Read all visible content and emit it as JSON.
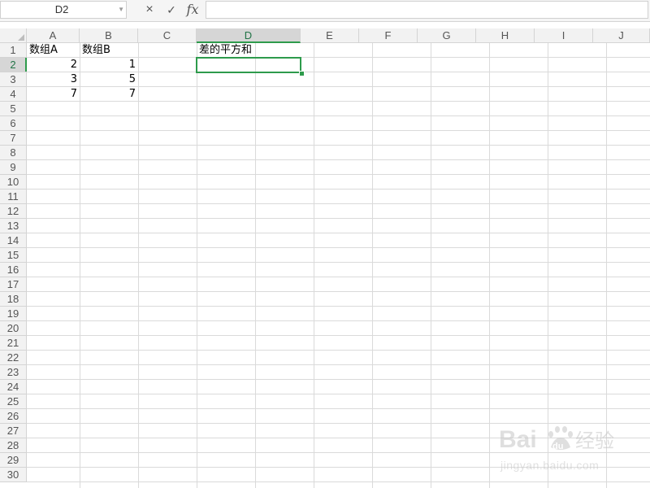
{
  "formula_bar": {
    "name_box": "D2",
    "cancel_icon": "×",
    "enter_icon": "✓",
    "fx_label": "fx",
    "formula_value": ""
  },
  "columns": [
    "A",
    "B",
    "C",
    "D",
    "E",
    "F",
    "G",
    "H",
    "I",
    "J"
  ],
  "active_column": "D",
  "rows": [
    "1",
    "2",
    "3",
    "4",
    "5",
    "6",
    "7",
    "8",
    "9",
    "10",
    "11",
    "12",
    "13",
    "14",
    "15",
    "16",
    "17",
    "18",
    "19",
    "20",
    "21",
    "22",
    "23",
    "24",
    "25",
    "26",
    "27",
    "28",
    "29",
    "30"
  ],
  "active_row": "2",
  "cells": {
    "A1": "数组A",
    "B1": "数组B",
    "D1": "差的平方和",
    "A2": "2",
    "B2": "1",
    "A3": "3",
    "B3": "5",
    "A4": "7",
    "B4": "7"
  },
  "watermark": {
    "brand": "Baidu经验",
    "url": "jingyan.baidu.com"
  },
  "colors": {
    "accent": "#2e9b4c",
    "header_bg": "#f2f2f2",
    "active_header_bg": "#d6d6d6",
    "gridline": "#dadada"
  },
  "icons": {
    "name_box_dropdown": "chevron-down-icon",
    "cancel": "close-icon",
    "enter": "check-icon",
    "function": "fx-icon"
  }
}
